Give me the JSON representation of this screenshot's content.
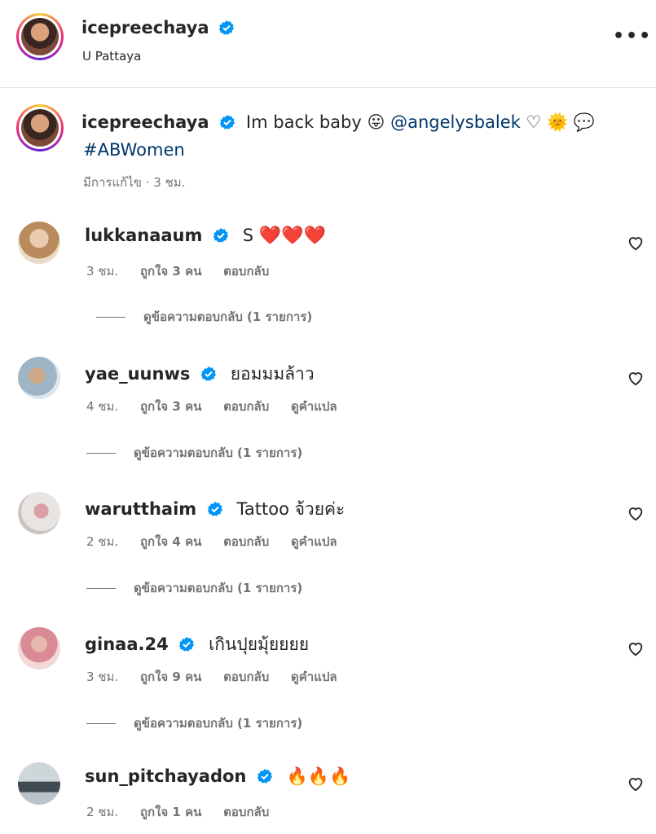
{
  "post_header": {
    "username": "icepreechaya",
    "location": "U Pattaya",
    "more_label": "•••"
  },
  "caption": {
    "username": "icepreechaya",
    "text": "Im back baby",
    "emoji": "😛",
    "mention": "@angelysbalek",
    "trailing": "♡ 🌞 💬",
    "hashtag": "#ABWomen",
    "edited": "มีการแก้ไข · 3 ชม."
  },
  "comments": [
    {
      "username": "lukkanaaum",
      "text": "S",
      "emoji": "❤️❤️❤️",
      "time": "3 ชม.",
      "likes": "ถูกใจ 3 คน",
      "reply": "ตอบกลับ",
      "translate": "",
      "view_replies": "ดูข้อความตอบกลับ (1 รายการ)"
    },
    {
      "username": "yae_uunws",
      "text": "ยอมมมล้าว",
      "emoji": "",
      "time": "4 ชม.",
      "likes": "ถูกใจ 3 คน",
      "reply": "ตอบกลับ",
      "translate": "ดูคำแปล",
      "view_replies": "ดูข้อความตอบกลับ (1 รายการ)"
    },
    {
      "username": "warutthaim",
      "text": "Tattoo จ้วยค่ะ",
      "emoji": "",
      "time": "2 ชม.",
      "likes": "ถูกใจ 4 คน",
      "reply": "ตอบกลับ",
      "translate": "ดูคำแปล",
      "view_replies": "ดูข้อความตอบกลับ (1 รายการ)"
    },
    {
      "username": "ginaa.24",
      "text": "เกินปุยมุ้ยยยย",
      "emoji": "",
      "time": "3 ชม.",
      "likes": "ถูกใจ 9 คน",
      "reply": "ตอบกลับ",
      "translate": "ดูคำแปล",
      "view_replies": "ดูข้อความตอบกลับ (1 รายการ)"
    },
    {
      "username": "sun_pitchayadon",
      "text": "",
      "emoji": "🔥🔥🔥",
      "time": "2 ชม.",
      "likes": "ถูกใจ 1 คน",
      "reply": "ตอบกลับ",
      "translate": "",
      "view_replies": ""
    }
  ],
  "colors": {
    "verified": "#0095f6",
    "link": "#00376b",
    "muted": "#737373"
  }
}
